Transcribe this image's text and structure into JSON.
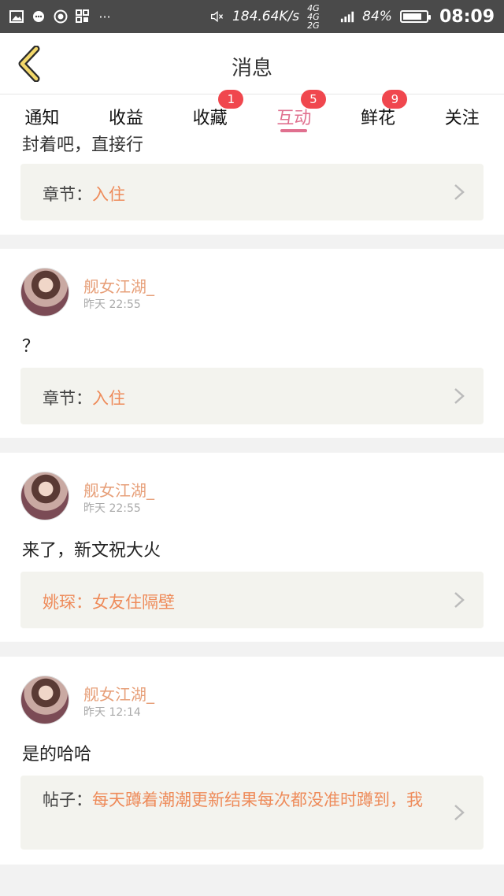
{
  "status_bar": {
    "net_speed": "184.64K/s",
    "network": "4G 4G 2G",
    "battery": "84%",
    "battery_level": 0.84,
    "time": "08:09"
  },
  "header": {
    "title": "消息"
  },
  "tabs": [
    {
      "label": "通知",
      "badge": ""
    },
    {
      "label": "收益",
      "badge": ""
    },
    {
      "label": "收藏",
      "badge": "1"
    },
    {
      "label": "互动",
      "badge": "5",
      "active": true
    },
    {
      "label": "鲜花",
      "badge": "9"
    },
    {
      "label": "关注",
      "badge": ""
    }
  ],
  "feed": {
    "partial": {
      "text": "封着吧，直接行",
      "ref_label": "章节：",
      "ref_value": "入住"
    },
    "items": [
      {
        "user": "舰女江湖_",
        "time": "昨天 22:55",
        "message": "？",
        "ref_label": "章节：",
        "ref_value": "入住"
      },
      {
        "user": "舰女江湖_",
        "time": "昨天 22:55",
        "message": "来了，新文祝大火",
        "ref_label": "",
        "ref_value": "姚琛：女友住隔壁"
      },
      {
        "user": "舰女江湖_",
        "time": "昨天 12:14",
        "message": "是的哈哈",
        "ref_label": "帖子：",
        "ref_value": "每天蹲着潮潮更新结果每次都没准时蹲到，我"
      }
    ]
  }
}
